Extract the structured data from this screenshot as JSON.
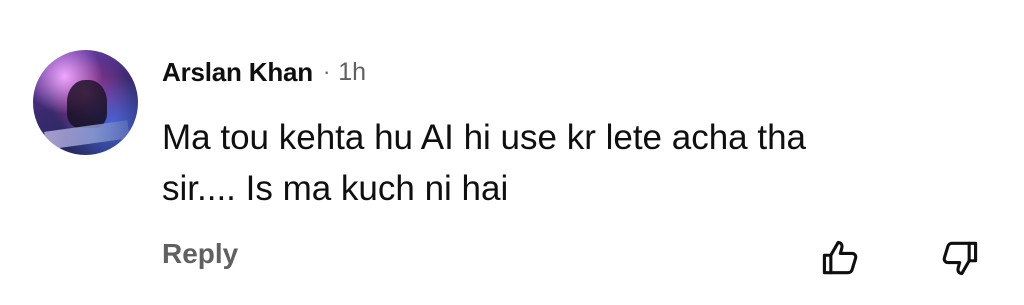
{
  "comment": {
    "author": "Arslan Khan",
    "separator": "·",
    "time": "1h",
    "text_lines": [
      "Ma tou kehta hu AI hi use kr lete acha tha",
      "sir.... Is ma kuch ni hai"
    ],
    "reply_label": "Reply"
  },
  "icons": {
    "avatar": "user-avatar",
    "like": "thumbs-up-icon",
    "dislike": "thumbs-down-icon"
  },
  "colors": {
    "author": "#0f0f0f",
    "secondary_text": "#606060",
    "icon": "#0f0f0f",
    "background": "#ffffff"
  }
}
